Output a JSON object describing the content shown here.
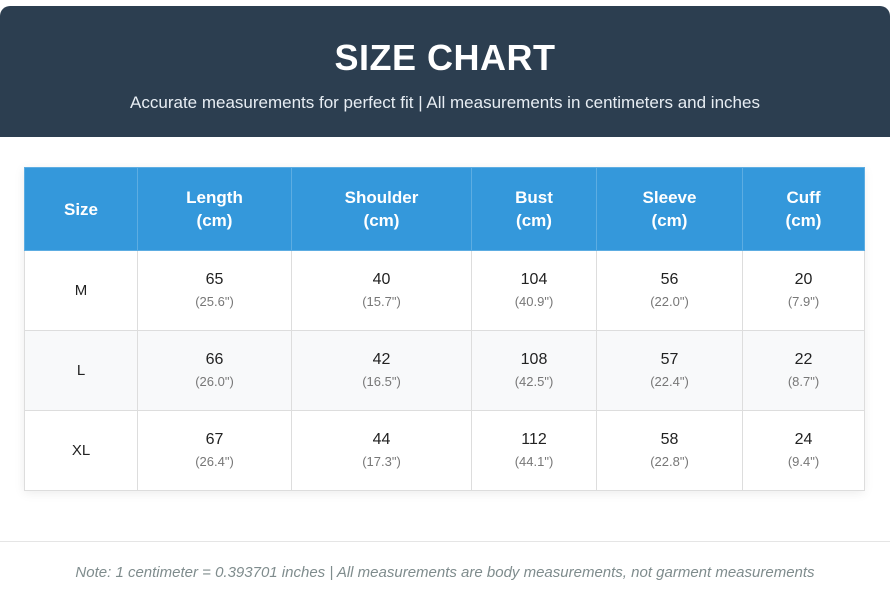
{
  "header": {
    "title": "SIZE CHART",
    "subtitle": "Accurate measurements for perfect fit | All measurements in centimeters and inches"
  },
  "table": {
    "columns": [
      {
        "name": "Size",
        "unit": ""
      },
      {
        "name": "Length",
        "unit": "(cm)"
      },
      {
        "name": "Shoulder",
        "unit": "(cm)"
      },
      {
        "name": "Bust",
        "unit": "(cm)"
      },
      {
        "name": "Sleeve",
        "unit": "(cm)"
      },
      {
        "name": "Cuff",
        "unit": "(cm)"
      }
    ],
    "rows": [
      {
        "size": "M",
        "cells": [
          {
            "cm": "65",
            "inch": "(25.6\")"
          },
          {
            "cm": "40",
            "inch": "(15.7\")"
          },
          {
            "cm": "104",
            "inch": "(40.9\")"
          },
          {
            "cm": "56",
            "inch": "(22.0\")"
          },
          {
            "cm": "20",
            "inch": "(7.9\")"
          }
        ]
      },
      {
        "size": "L",
        "cells": [
          {
            "cm": "66",
            "inch": "(26.0\")"
          },
          {
            "cm": "42",
            "inch": "(16.5\")"
          },
          {
            "cm": "108",
            "inch": "(42.5\")"
          },
          {
            "cm": "57",
            "inch": "(22.4\")"
          },
          {
            "cm": "22",
            "inch": "(8.7\")"
          }
        ]
      },
      {
        "size": "XL",
        "cells": [
          {
            "cm": "67",
            "inch": "(26.4\")"
          },
          {
            "cm": "44",
            "inch": "(17.3\")"
          },
          {
            "cm": "112",
            "inch": "(44.1\")"
          },
          {
            "cm": "58",
            "inch": "(22.8\")"
          },
          {
            "cm": "24",
            "inch": "(9.4\")"
          }
        ]
      }
    ]
  },
  "footer": {
    "note": "Note: 1 centimeter = 0.393701 inches | All measurements are body measurements, not garment measurements"
  },
  "colors": {
    "header_bg": "#2c3e50",
    "table_header_bg": "#3498db",
    "alt_row_bg": "#f8f9fa",
    "note_text": "#7f8c8d"
  }
}
